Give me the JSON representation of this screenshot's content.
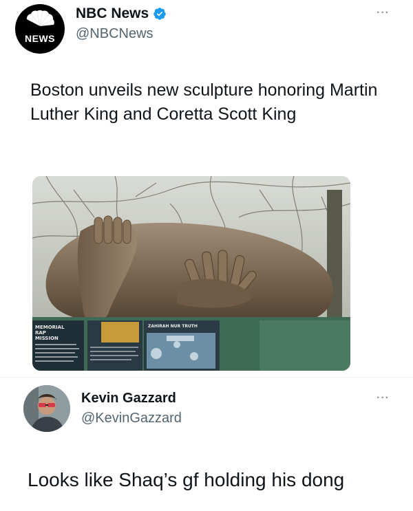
{
  "tweet": {
    "author": {
      "name": "NBC News",
      "handle": "@NBCNews",
      "avatar_text": "NEWS",
      "verified": true
    },
    "more_label": "···",
    "text": "Boston unveils new sculpture honoring Martin Luther King and Coretta Scott King",
    "media": {
      "sign_texts": [
        "MEMORIAL",
        "RAP",
        "MISSION",
        "ZAHIRAH NUR TRUTH"
      ]
    }
  },
  "reply": {
    "author": {
      "name": "Kevin Gazzard",
      "handle": "@KevinGazzard"
    },
    "more_label": "···",
    "text": "Looks like Shaq’s gf holding his dong"
  },
  "colors": {
    "text_primary": "#0f1419",
    "text_secondary": "#536471",
    "verified_blue": "#1d9bf0",
    "divider": "#eff3f4"
  }
}
